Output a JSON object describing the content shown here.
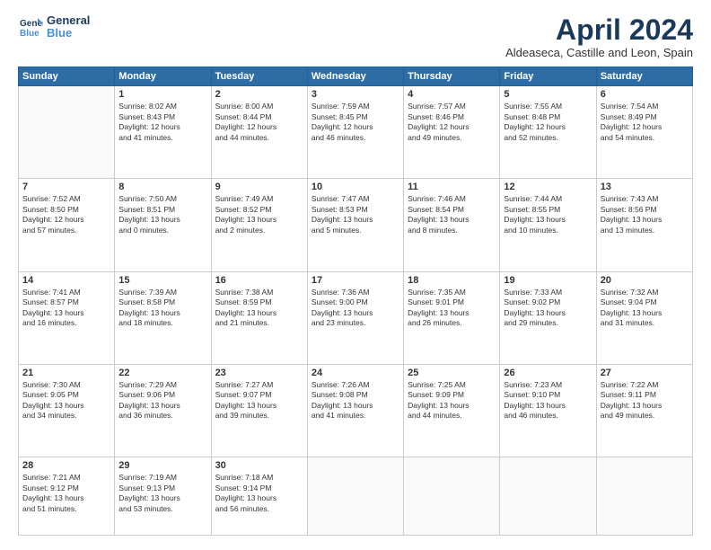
{
  "logo": {
    "line1": "General",
    "line2": "Blue"
  },
  "title": "April 2024",
  "subtitle": "Aldeaseca, Castille and Leon, Spain",
  "days": [
    "Sunday",
    "Monday",
    "Tuesday",
    "Wednesday",
    "Thursday",
    "Friday",
    "Saturday"
  ],
  "weeks": [
    [
      {
        "day": "",
        "content": ""
      },
      {
        "day": "1",
        "content": "Sunrise: 8:02 AM\nSunset: 8:43 PM\nDaylight: 12 hours\nand 41 minutes."
      },
      {
        "day": "2",
        "content": "Sunrise: 8:00 AM\nSunset: 8:44 PM\nDaylight: 12 hours\nand 44 minutes."
      },
      {
        "day": "3",
        "content": "Sunrise: 7:59 AM\nSunset: 8:45 PM\nDaylight: 12 hours\nand 46 minutes."
      },
      {
        "day": "4",
        "content": "Sunrise: 7:57 AM\nSunset: 8:46 PM\nDaylight: 12 hours\nand 49 minutes."
      },
      {
        "day": "5",
        "content": "Sunrise: 7:55 AM\nSunset: 8:48 PM\nDaylight: 12 hours\nand 52 minutes."
      },
      {
        "day": "6",
        "content": "Sunrise: 7:54 AM\nSunset: 8:49 PM\nDaylight: 12 hours\nand 54 minutes."
      }
    ],
    [
      {
        "day": "7",
        "content": "Sunrise: 7:52 AM\nSunset: 8:50 PM\nDaylight: 12 hours\nand 57 minutes."
      },
      {
        "day": "8",
        "content": "Sunrise: 7:50 AM\nSunset: 8:51 PM\nDaylight: 13 hours\nand 0 minutes."
      },
      {
        "day": "9",
        "content": "Sunrise: 7:49 AM\nSunset: 8:52 PM\nDaylight: 13 hours\nand 2 minutes."
      },
      {
        "day": "10",
        "content": "Sunrise: 7:47 AM\nSunset: 8:53 PM\nDaylight: 13 hours\nand 5 minutes."
      },
      {
        "day": "11",
        "content": "Sunrise: 7:46 AM\nSunset: 8:54 PM\nDaylight: 13 hours\nand 8 minutes."
      },
      {
        "day": "12",
        "content": "Sunrise: 7:44 AM\nSunset: 8:55 PM\nDaylight: 13 hours\nand 10 minutes."
      },
      {
        "day": "13",
        "content": "Sunrise: 7:43 AM\nSunset: 8:56 PM\nDaylight: 13 hours\nand 13 minutes."
      }
    ],
    [
      {
        "day": "14",
        "content": "Sunrise: 7:41 AM\nSunset: 8:57 PM\nDaylight: 13 hours\nand 16 minutes."
      },
      {
        "day": "15",
        "content": "Sunrise: 7:39 AM\nSunset: 8:58 PM\nDaylight: 13 hours\nand 18 minutes."
      },
      {
        "day": "16",
        "content": "Sunrise: 7:38 AM\nSunset: 8:59 PM\nDaylight: 13 hours\nand 21 minutes."
      },
      {
        "day": "17",
        "content": "Sunrise: 7:36 AM\nSunset: 9:00 PM\nDaylight: 13 hours\nand 23 minutes."
      },
      {
        "day": "18",
        "content": "Sunrise: 7:35 AM\nSunset: 9:01 PM\nDaylight: 13 hours\nand 26 minutes."
      },
      {
        "day": "19",
        "content": "Sunrise: 7:33 AM\nSunset: 9:02 PM\nDaylight: 13 hours\nand 29 minutes."
      },
      {
        "day": "20",
        "content": "Sunrise: 7:32 AM\nSunset: 9:04 PM\nDaylight: 13 hours\nand 31 minutes."
      }
    ],
    [
      {
        "day": "21",
        "content": "Sunrise: 7:30 AM\nSunset: 9:05 PM\nDaylight: 13 hours\nand 34 minutes."
      },
      {
        "day": "22",
        "content": "Sunrise: 7:29 AM\nSunset: 9:06 PM\nDaylight: 13 hours\nand 36 minutes."
      },
      {
        "day": "23",
        "content": "Sunrise: 7:27 AM\nSunset: 9:07 PM\nDaylight: 13 hours\nand 39 minutes."
      },
      {
        "day": "24",
        "content": "Sunrise: 7:26 AM\nSunset: 9:08 PM\nDaylight: 13 hours\nand 41 minutes."
      },
      {
        "day": "25",
        "content": "Sunrise: 7:25 AM\nSunset: 9:09 PM\nDaylight: 13 hours\nand 44 minutes."
      },
      {
        "day": "26",
        "content": "Sunrise: 7:23 AM\nSunset: 9:10 PM\nDaylight: 13 hours\nand 46 minutes."
      },
      {
        "day": "27",
        "content": "Sunrise: 7:22 AM\nSunset: 9:11 PM\nDaylight: 13 hours\nand 49 minutes."
      }
    ],
    [
      {
        "day": "28",
        "content": "Sunrise: 7:21 AM\nSunset: 9:12 PM\nDaylight: 13 hours\nand 51 minutes."
      },
      {
        "day": "29",
        "content": "Sunrise: 7:19 AM\nSunset: 9:13 PM\nDaylight: 13 hours\nand 53 minutes."
      },
      {
        "day": "30",
        "content": "Sunrise: 7:18 AM\nSunset: 9:14 PM\nDaylight: 13 hours\nand 56 minutes."
      },
      {
        "day": "",
        "content": ""
      },
      {
        "day": "",
        "content": ""
      },
      {
        "day": "",
        "content": ""
      },
      {
        "day": "",
        "content": ""
      }
    ]
  ]
}
